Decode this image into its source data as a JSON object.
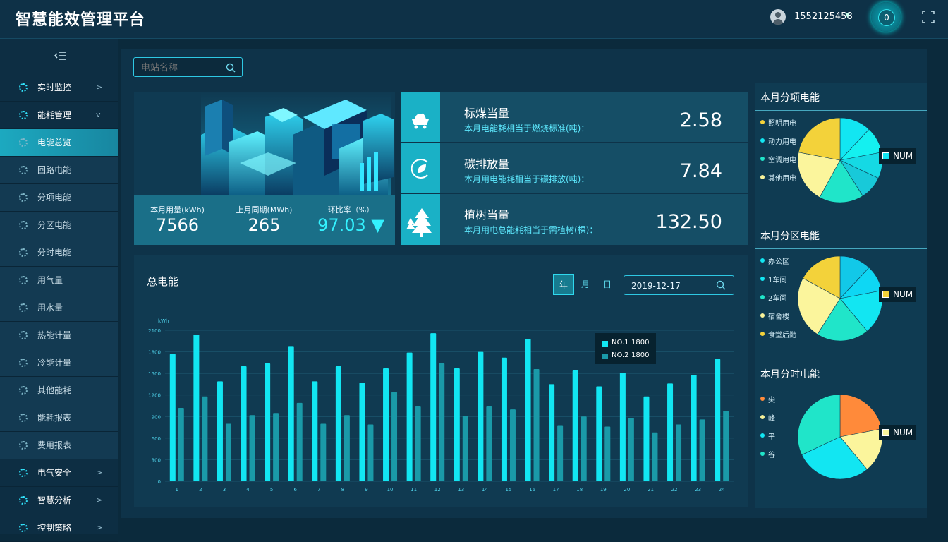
{
  "header": {
    "title": "智慧能效管理平台",
    "username": "1552125458",
    "notification_count": "0"
  },
  "search": {
    "placeholder": "电站名称"
  },
  "sidebar": {
    "items": [
      {
        "label": "实时监控",
        "type": "parent",
        "chevron": ">"
      },
      {
        "label": "能耗管理",
        "type": "parent",
        "chevron": "v"
      },
      {
        "label": "电能总览",
        "type": "active"
      },
      {
        "label": "回路电能",
        "type": "sub"
      },
      {
        "label": "分项电能",
        "type": "sub"
      },
      {
        "label": "分区电能",
        "type": "sub"
      },
      {
        "label": "分时电能",
        "type": "sub"
      },
      {
        "label": "用气量",
        "type": "sub"
      },
      {
        "label": "用水量",
        "type": "sub"
      },
      {
        "label": "热能计量",
        "type": "sub"
      },
      {
        "label": "冷能计量",
        "type": "sub"
      },
      {
        "label": "其他能耗",
        "type": "sub"
      },
      {
        "label": "能耗报表",
        "type": "sub"
      },
      {
        "label": "费用报表",
        "type": "sub"
      },
      {
        "label": "电气安全",
        "type": "parent",
        "chevron": ">"
      },
      {
        "label": "智慧分析",
        "type": "parent",
        "chevron": ">"
      },
      {
        "label": "控制策略",
        "type": "parent",
        "chevron": ">"
      }
    ]
  },
  "stats": [
    {
      "label": "本月用量(kWh)",
      "value": "7566"
    },
    {
      "label": "上月同期(MWh)",
      "value": "265"
    },
    {
      "label": "环比率（%）",
      "value": "97.03 ▼"
    }
  ],
  "metrics": [
    {
      "title": "标煤当量",
      "desc": "本月电能耗相当于燃烧标准(吨)：",
      "value": "2.58",
      "icon": "coal-cart-icon"
    },
    {
      "title": "碳排放量",
      "desc": "本月用电能耗相当于碳排放(吨)：",
      "value": "7.84",
      "icon": "leaf-co2-icon"
    },
    {
      "title": "植树当量",
      "desc": "本月用电总能耗相当于需植树(棵)：",
      "value": "132.50",
      "icon": "tree-icon"
    }
  ],
  "chart_panel": {
    "title": "总电能",
    "tabs": [
      "年",
      "月",
      "日"
    ],
    "active_tab": "年",
    "date": "2019-12-17"
  },
  "chart_data": {
    "type": "bar",
    "unit": "kWh",
    "categories": [
      "1",
      "2",
      "3",
      "4",
      "5",
      "6",
      "7",
      "8",
      "9",
      "10",
      "11",
      "12",
      "13",
      "14",
      "15",
      "16",
      "17",
      "18",
      "19",
      "20",
      "21",
      "22",
      "23",
      "24"
    ],
    "ylim": [
      0,
      2100
    ],
    "yticks": [
      0,
      300,
      600,
      900,
      1200,
      1500,
      1800,
      2100
    ],
    "series": [
      {
        "name": "NO.1",
        "color": "#12e6f2",
        "values": [
          1770,
          2040,
          1390,
          1600,
          1640,
          1880,
          1390,
          1600,
          1370,
          1570,
          1790,
          2060,
          1570,
          1800,
          1720,
          1980,
          1350,
          1550,
          1320,
          1510,
          1180,
          1360,
          1480,
          1700
        ]
      },
      {
        "name": "NO.2",
        "color": "#1a9aa8",
        "values": [
          1020,
          1180,
          800,
          920,
          950,
          1090,
          800,
          920,
          790,
          1240,
          1040,
          1640,
          910,
          1040,
          1000,
          1560,
          780,
          900,
          760,
          880,
          680,
          790,
          860,
          980
        ]
      }
    ],
    "tooltip": {
      "rows": [
        {
          "name": "NO.1",
          "value": "1800"
        },
        {
          "name": "NO.2",
          "value": "1800"
        }
      ]
    },
    "grid": true
  },
  "pies": [
    {
      "title": "本月分项电能",
      "tag": "NUM",
      "tag_color": "#12e6f2",
      "legend": [
        {
          "label": "照明用电",
          "color": "#f5d33a"
        },
        {
          "label": "动力用电",
          "color": "#12e6f2"
        },
        {
          "label": "空调用电",
          "color": "#20e5c9"
        },
        {
          "label": "其他用电",
          "color": "#f8f29a"
        }
      ],
      "slices": [
        {
          "value": 12,
          "color": "#12e6f2"
        },
        {
          "value": 10,
          "color": "#14f0f0"
        },
        {
          "value": 10,
          "color": "#15d9e4"
        },
        {
          "value": 9,
          "color": "#18c9d9"
        },
        {
          "value": 17,
          "color": "#20e5c9"
        },
        {
          "value": 20,
          "color": "#fbf59c"
        },
        {
          "value": 22,
          "color": "#f3d23a"
        }
      ]
    },
    {
      "title": "本月分区电能",
      "tag": "NUM",
      "tag_color": "#f3d23a",
      "legend": [
        {
          "label": "办公区",
          "color": "#12e6f2"
        },
        {
          "label": "1车间",
          "color": "#12e6f2"
        },
        {
          "label": "2车间",
          "color": "#20e5c9"
        },
        {
          "label": "宿舍楼",
          "color": "#f8f29a"
        },
        {
          "label": "食堂后勤",
          "color": "#f3d23a"
        }
      ],
      "slices": [
        {
          "value": 12,
          "color": "#12c8e8"
        },
        {
          "value": 10,
          "color": "#0ed7f4"
        },
        {
          "value": 17,
          "color": "#12e6f2"
        },
        {
          "value": 20,
          "color": "#20e5c9"
        },
        {
          "value": 24,
          "color": "#fbf59c"
        },
        {
          "value": 17,
          "color": "#f3d23a"
        }
      ]
    },
    {
      "title": "本月分时电能",
      "tag": "NUM",
      "tag_color": "#fbf59c",
      "legend": [
        {
          "label": "尖",
          "color": "#ff8a3a"
        },
        {
          "label": "峰",
          "color": "#f8f29a"
        },
        {
          "label": "平",
          "color": "#12e6f2"
        },
        {
          "label": "谷",
          "color": "#20e5c9"
        }
      ],
      "slices": [
        {
          "value": 22,
          "color": "#ff8a3a"
        },
        {
          "value": 17,
          "color": "#fbf59c"
        },
        {
          "value": 29,
          "color": "#12e6f2"
        },
        {
          "value": 32,
          "color": "#20e5c9"
        }
      ]
    }
  ]
}
